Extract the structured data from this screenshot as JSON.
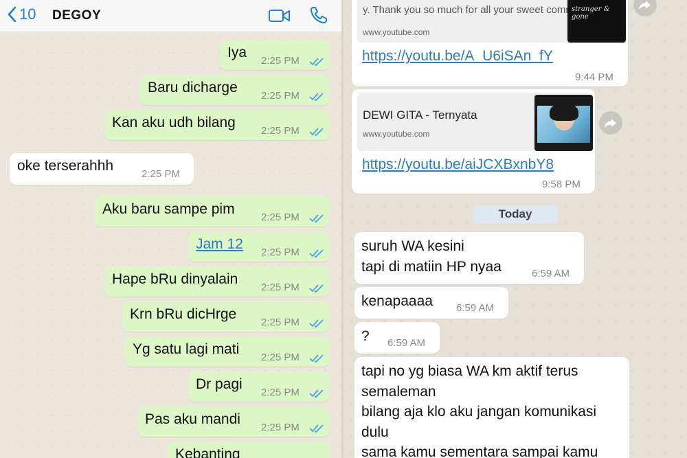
{
  "left_chat": {
    "back_count": "10",
    "contact_name": "DEGOY",
    "icons": {
      "back": "chevron-left-icon",
      "video": "video-call-icon",
      "phone": "phone-call-icon",
      "tick": "double-check-icon"
    },
    "messages": [
      {
        "dir": "out",
        "text": "Iya",
        "time": "2:25 PM"
      },
      {
        "dir": "out",
        "text": "Baru dicharge",
        "time": "2:25 PM"
      },
      {
        "dir": "out",
        "text": "Kan aku udh bilang",
        "time": "2:25 PM"
      },
      {
        "dir": "in",
        "text": "oke terserahhh",
        "time": "2:25 PM"
      },
      {
        "dir": "out",
        "text": "Aku baru sampe pim",
        "time": "2:25 PM"
      },
      {
        "dir": "out",
        "text": "Jam 12",
        "time": "2:25 PM"
      },
      {
        "dir": "out",
        "text": "Hape bRu dinyalain",
        "time": "2:25 PM"
      },
      {
        "dir": "out",
        "text": "Krn bRu dicHrge",
        "time": "2:25 PM"
      },
      {
        "dir": "out",
        "text": "Yg satu lagi mati",
        "time": "2:25 PM"
      },
      {
        "dir": "out",
        "text": "Dr pagi",
        "time": "2:25 PM"
      },
      {
        "dir": "out",
        "text": "Pas aku mandi",
        "time": "2:25 PM"
      },
      {
        "dir": "out",
        "text": "Kebanting",
        "time": ""
      }
    ]
  },
  "right_chat": {
    "link1": {
      "card_text": "y. Thank you so much for all your sweet comments ! :)",
      "domain": "www.youtube.com",
      "url": "https://youtu.be/A_U6iSAn_fY",
      "time": "9:44 PM",
      "thumb_text": "stranger & gone"
    },
    "link2": {
      "title": "DEWI GITA - Ternyata",
      "domain": "www.youtube.com",
      "url": "https://youtu.be/aiJCXBxnbY8",
      "time": "9:58 PM"
    },
    "date_divider": "Today",
    "messages": [
      {
        "text": "suruh WA kesini\ntapi di matiin HP nyaa",
        "time": "6:59 AM"
      },
      {
        "text": "kenapaaaa",
        "time": "6:59 AM"
      },
      {
        "text": "?",
        "time": "6:59 AM"
      },
      {
        "text": "tapi no yg biasa WA km aktif terus\nsemaleman\nbilang aja klo aku jangan komunikasi\ndulu\nsama kamu sementara sampai kamu",
        "time": ""
      }
    ],
    "forward_icon": "forward-icon"
  },
  "colors": {
    "outgoing": "#dcf7c5",
    "incoming": "#ffffff",
    "link": "#2a7bc0",
    "tick": "#4a9fe8",
    "accent": "#1a7fe0"
  }
}
